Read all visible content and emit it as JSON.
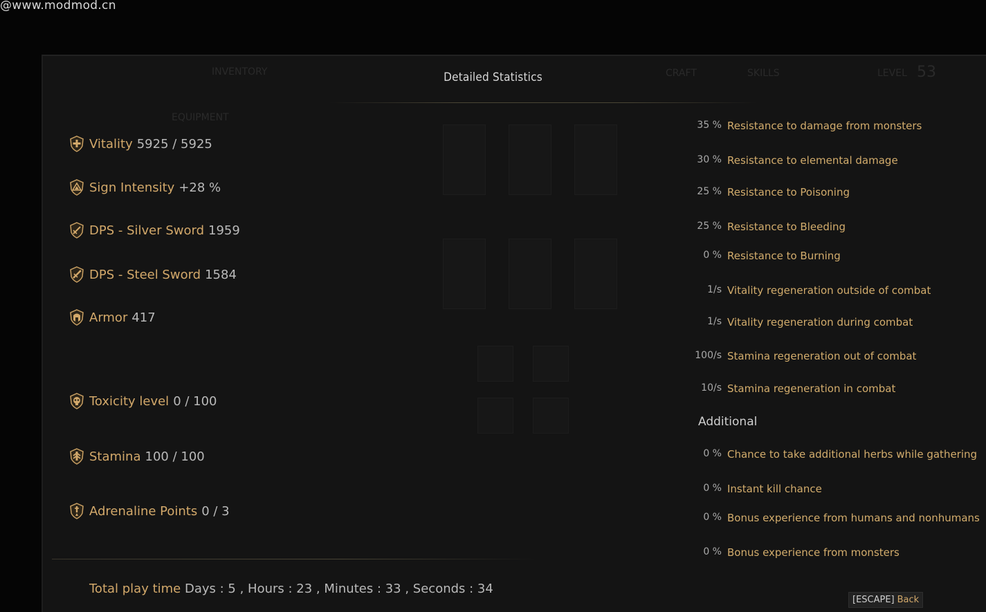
{
  "watermark": "@www.modmod.cn",
  "header": {
    "title": "Detailed Statistics",
    "ghost_tabs": [
      "INVENTORY",
      "CRAFT",
      "SKILLS",
      "LEVEL"
    ],
    "ghost_level": "53",
    "ghost_equipment": "EQUIPMENT"
  },
  "left_stats": [
    {
      "label": "Vitality",
      "value": "5925 / 5925",
      "icon": "vitality-icon"
    },
    {
      "label": "Sign Intensity",
      "value": "+28 %",
      "icon": "sign-icon"
    },
    {
      "label": "DPS - Silver Sword",
      "value": "1959",
      "icon": "silver-sword-icon"
    },
    {
      "label": "DPS - Steel Sword",
      "value": "1584",
      "icon": "steel-sword-icon"
    },
    {
      "label": "Armor",
      "value": "417",
      "icon": "armor-icon"
    },
    {
      "label": "Toxicity level",
      "value": "0 / 100",
      "icon": "toxicity-icon"
    },
    {
      "label": "Stamina",
      "value": "100 / 100",
      "icon": "stamina-icon"
    },
    {
      "label": "Adrenaline Points",
      "value": "0 / 3",
      "icon": "adrenaline-icon"
    }
  ],
  "right_stats": [
    {
      "num": "35 %",
      "label": "Resistance to damage from monsters"
    },
    {
      "num": "30 %",
      "label": "Resistance to elemental damage"
    },
    {
      "num": "25 %",
      "label": "Resistance to Poisoning"
    },
    {
      "num": "25 %",
      "label": "Resistance to Bleeding"
    },
    {
      "num": "0 %",
      "label": "Resistance to Burning"
    },
    {
      "num": "1/s",
      "label": "Vitality regeneration outside of combat"
    },
    {
      "num": "1/s",
      "label": "Vitality regeneration during combat"
    },
    {
      "num": "100/s",
      "label": "Stamina regeneration out of combat"
    },
    {
      "num": "10/s",
      "label": "Stamina regeneration in combat"
    }
  ],
  "additional": {
    "title": "Additional",
    "items": [
      {
        "num": "0 %",
        "label": "Chance to take additional herbs while gathering"
      },
      {
        "num": "0 %",
        "label": "Instant kill chance"
      },
      {
        "num": "0 %",
        "label": "Bonus experience from humans and nonhumans"
      },
      {
        "num": "0 %",
        "label": "Bonus experience from monsters"
      }
    ]
  },
  "footer": {
    "playtime_label": "Total play time",
    "playtime_value": "Days : 5 , Hours : 23 , Minutes : 33 , Seconds : 34",
    "escape_key": "[ESCAPE]",
    "escape_action": "Back"
  },
  "colors": {
    "accent": "#d2a86a",
    "text": "#b9b9b9",
    "panel": "#141414"
  }
}
